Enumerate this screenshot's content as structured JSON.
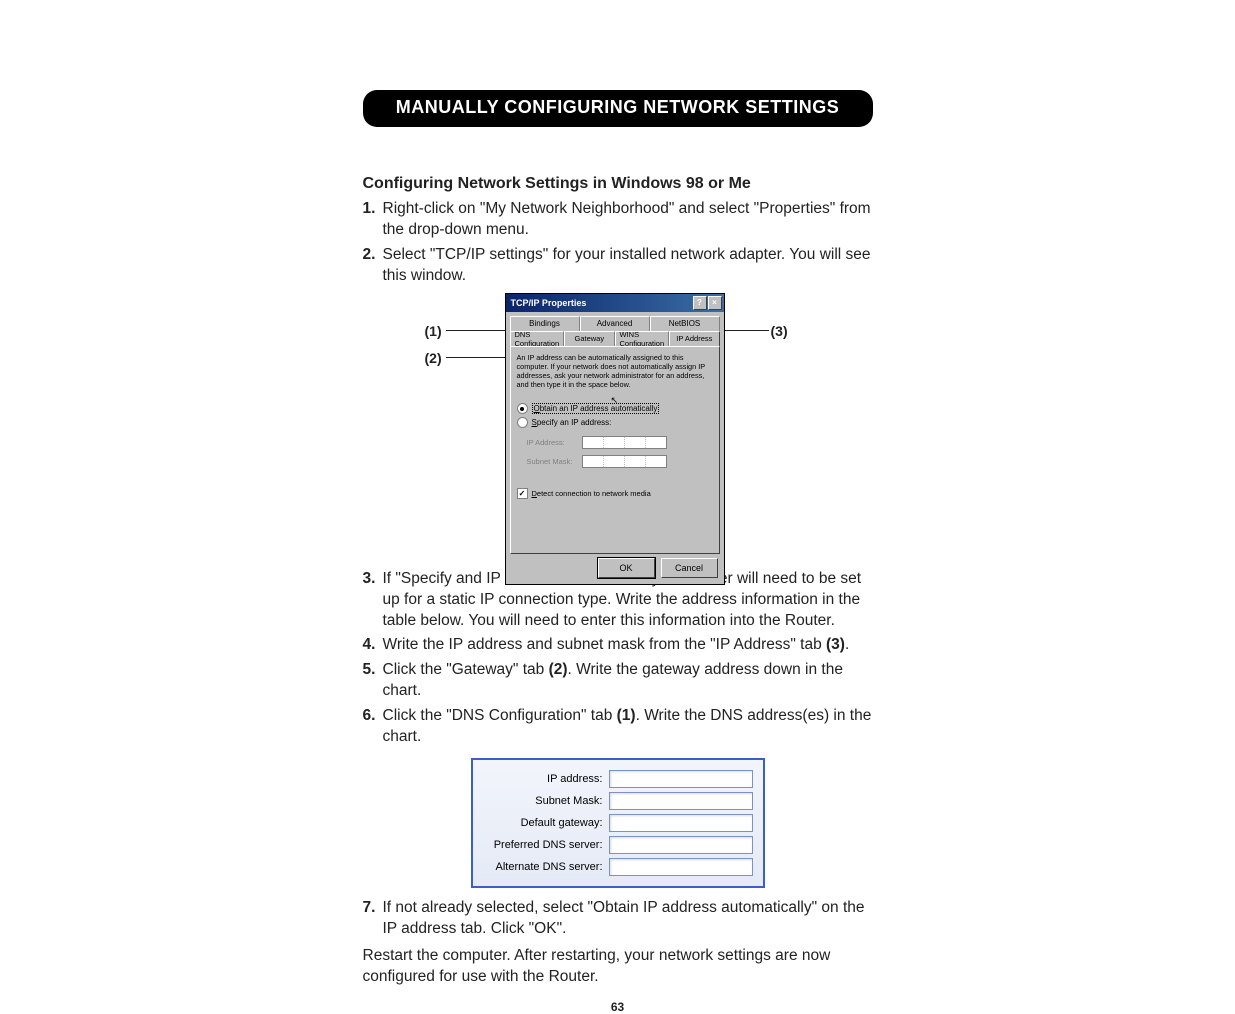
{
  "banner": "MANUALLY CONFIGURING NETWORK SETTINGS",
  "subtitle": "Configuring Network Settings in Windows 98 or Me",
  "steps_a": [
    {
      "num": "1.",
      "text": "Right-click on \"My Network Neighborhood\" and select \"Properties\" from the drop-down menu."
    },
    {
      "num": "2.",
      "text": "Select \"TCP/IP settings\" for your installed network adapter. You will see this window."
    }
  ],
  "callouts": {
    "c1": "(1)",
    "c2": "(2)",
    "c3": "(3)"
  },
  "dialog": {
    "title": "TCP/IP Properties",
    "help_btn": "?",
    "close_btn": "×",
    "tabs_row1": [
      "Bindings",
      "Advanced",
      "NetBIOS"
    ],
    "tabs_row2": [
      "DNS Configuration",
      "Gateway",
      "WINS Configuration",
      "IP Address"
    ],
    "helptext": "An IP address can be automatically assigned to this computer. If your network does not automatically assign IP addresses, ask your network administrator for an address, and then type it in the space below.",
    "radio1_pre": "O",
    "radio1": "btain an IP address automatically",
    "radio2_pre": "S",
    "radio2": "pecify an IP address:",
    "ip_label": "IP Address:",
    "mask_label": "Subnet Mask:",
    "detect_pre": "D",
    "detect": "etect connection to network media",
    "ok": "OK",
    "cancel": "Cancel"
  },
  "steps_b": [
    {
      "num": "3.",
      "text": "If \"Specify and IP address\" is selected, your Router will need to be set up for a static IP connection type. Write the address information in the table below. You will need to enter this information into the Router."
    },
    {
      "num": "4.",
      "pre": "Write the IP address and subnet mask from the \"IP Address\" tab ",
      "bold": "(3)",
      "post": "."
    },
    {
      "num": "5.",
      "pre": "Click the \"Gateway\" tab ",
      "bold": "(2)",
      "post": ". Write the gateway address down in the chart."
    },
    {
      "num": "6.",
      "pre": "Click the \"DNS Configuration\" tab ",
      "bold": "(1)",
      "post": ". Write the DNS address(es) in the chart."
    }
  ],
  "table_rows": [
    "IP address:",
    "Subnet Mask:",
    "Default gateway:",
    "Preferred DNS server:",
    "Alternate DNS server:"
  ],
  "step7": {
    "num": "7.",
    "text": "If not already selected, select \"Obtain IP address automatically\" on the IP address tab. Click \"OK\"."
  },
  "closing": "Restart the computer. After restarting, your network settings are now configured for use with the Router.",
  "page_number": "63"
}
